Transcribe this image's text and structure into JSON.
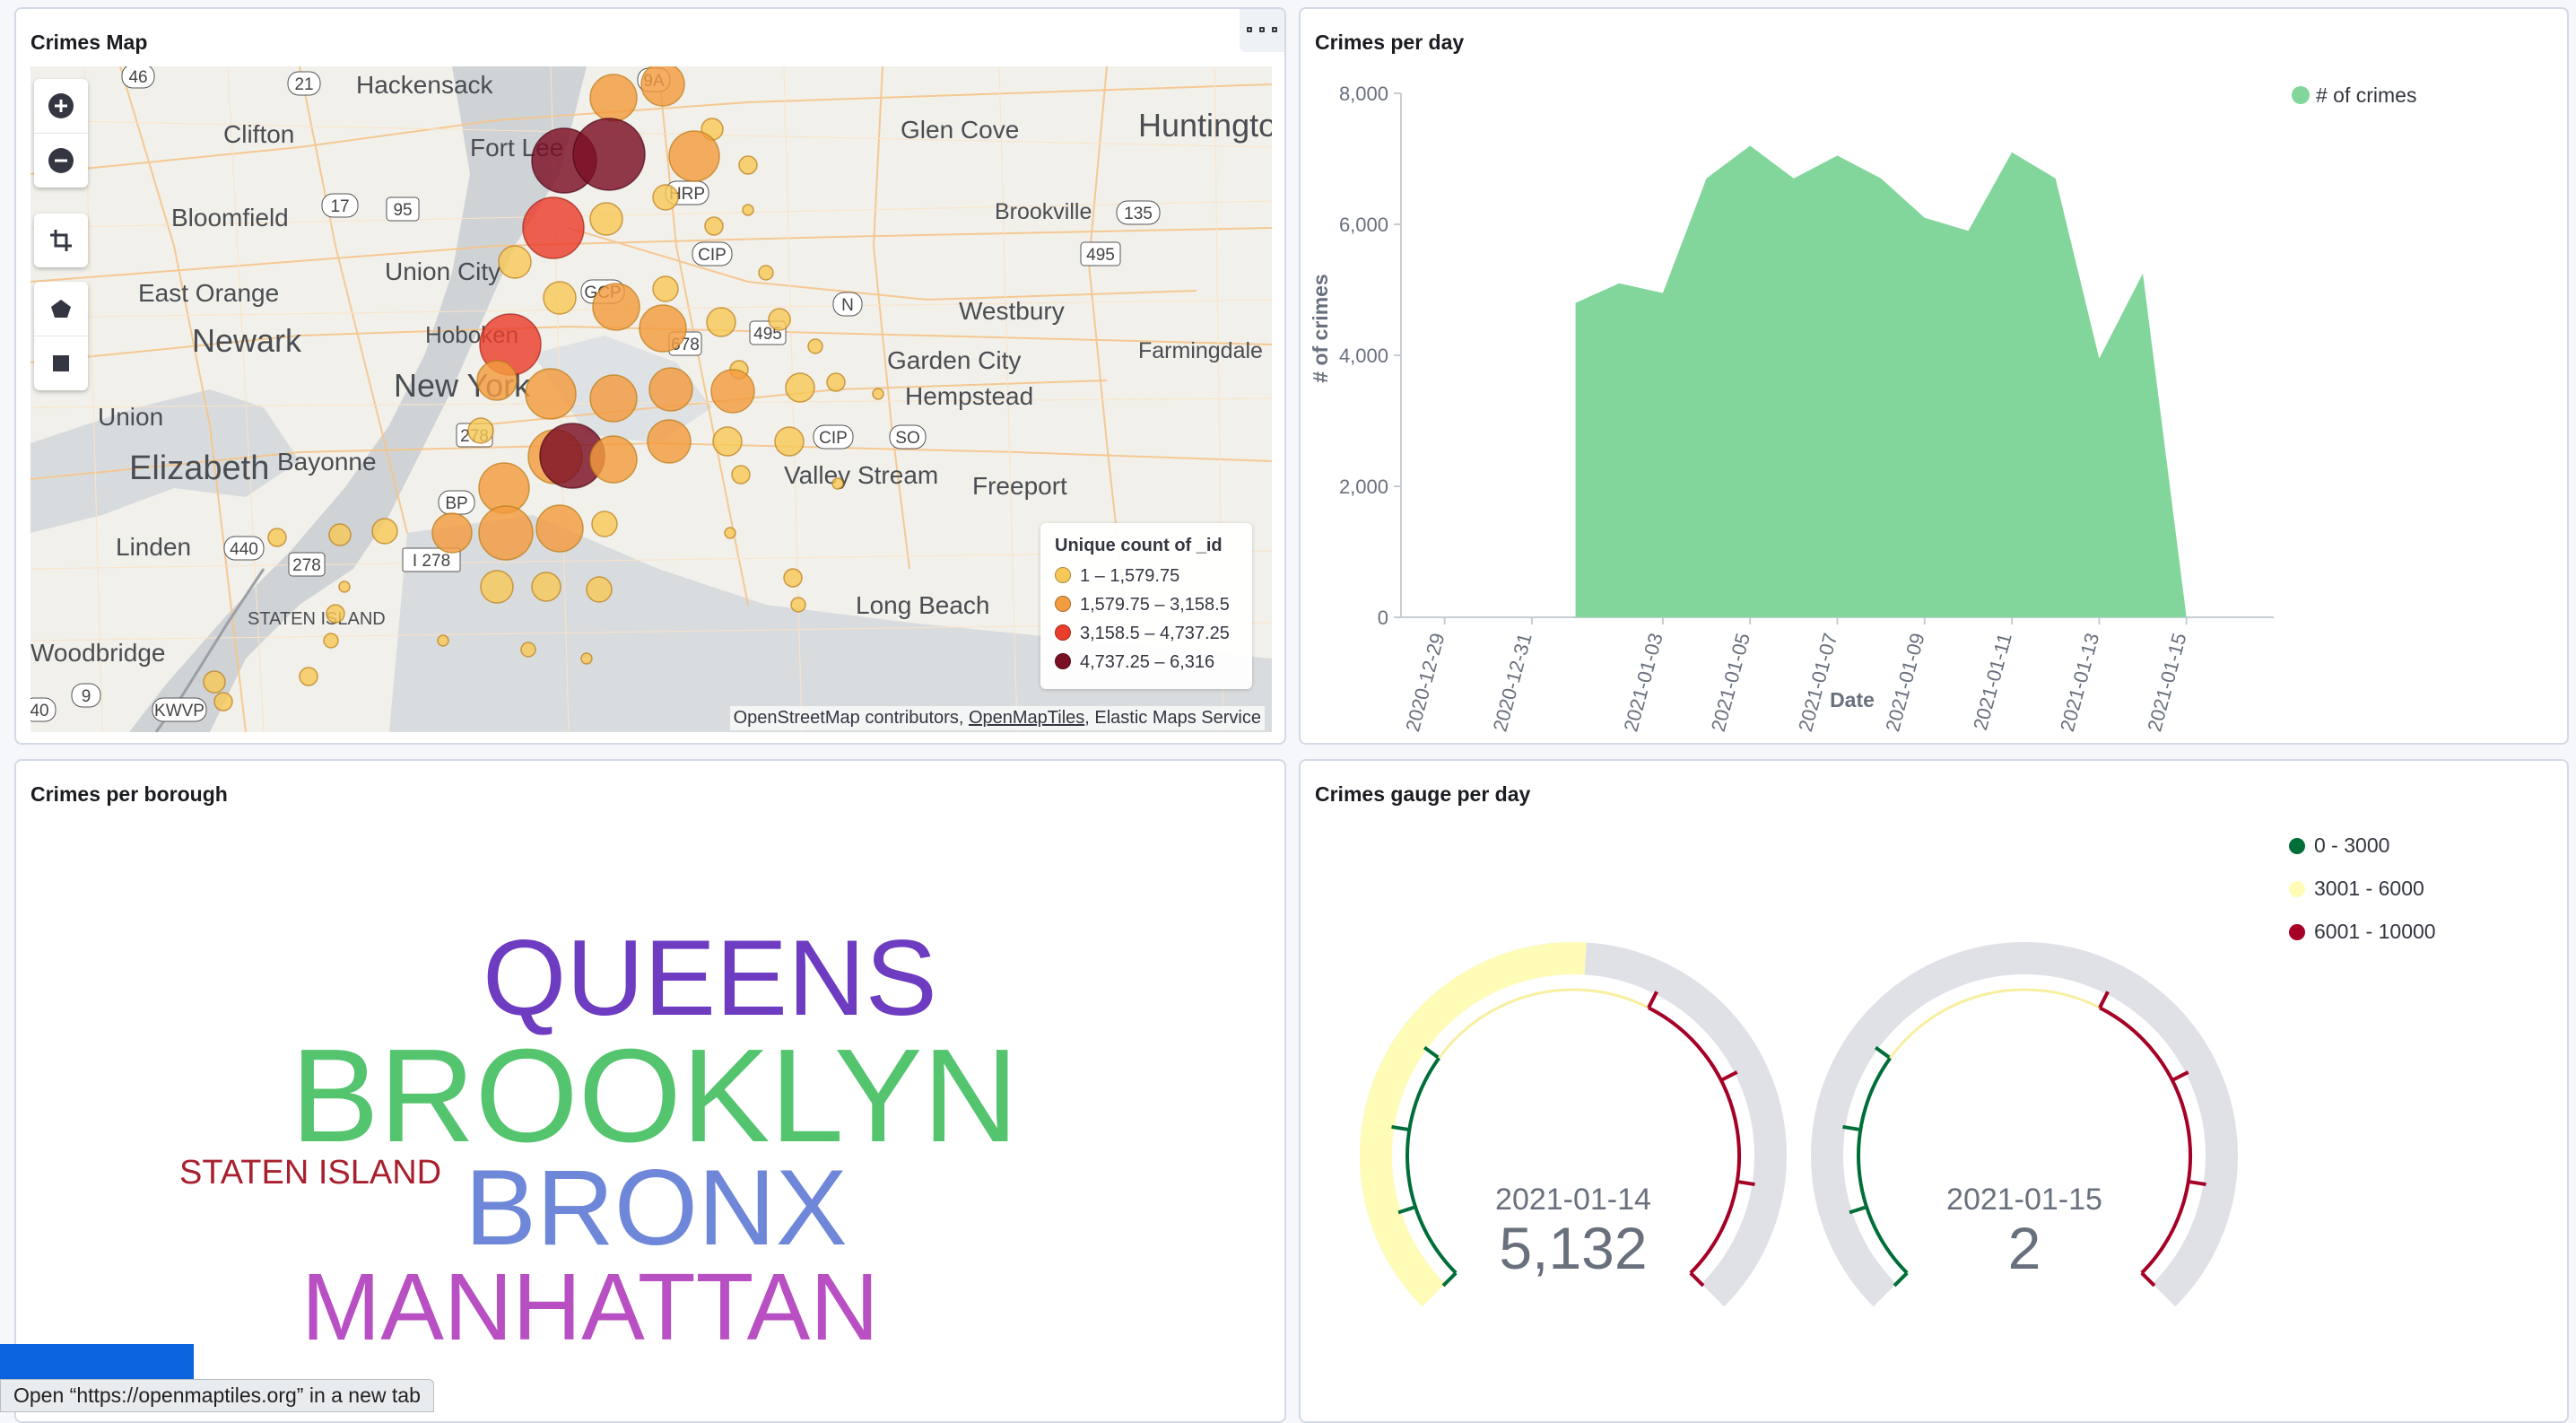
{
  "panels": {
    "map": {
      "title": "Crimes Map",
      "place_labels": [
        "Hackensack",
        "Clifton",
        "Fort Lee",
        "Glen Cove",
        "Huntington",
        "Bloomfield",
        "Brookville",
        "Union City",
        "East Orange",
        "Westbury",
        "Newark",
        "Hoboken",
        "Garden City",
        "Farmingdale",
        "New York",
        "Hempstead",
        "Union",
        "Elizabeth",
        "Bayonne",
        "Valley Stream",
        "Freeport",
        "Linden",
        "Long Beach",
        "STATEN ISLAND",
        "Woodbridge"
      ],
      "road_labels": [
        "46",
        "21",
        "17",
        "95",
        "HRP",
        "CIP",
        "135",
        "495",
        "GCP",
        "678",
        "N",
        "495",
        "278",
        "CIP",
        "SO",
        "BP",
        "440",
        "278",
        "I 278",
        "9",
        "KWVP",
        "40",
        "9A"
      ],
      "legend": {
        "title": "Unique count of _id",
        "items": [
          {
            "label": "1 – 1,579.75",
            "color": "#f6c858"
          },
          {
            "label": "1,579.75 – 3,158.5",
            "color": "#f39b3f"
          },
          {
            "label": "3,158.5 – 4,737.25",
            "color": "#ea3d2c"
          },
          {
            "label": "4,737.25 – 6,316",
            "color": "#7b0f24"
          }
        ]
      },
      "attribution": {
        "a": "OpenStreetMap contributors, ",
        "b": "OpenMapTiles",
        "c": ", Elastic Maps Service"
      },
      "tools": [
        "plus-icon",
        "minus-icon",
        "crop-icon",
        "polygon-icon",
        "square-icon"
      ]
    },
    "per_day": {
      "title": "Crimes per day"
    },
    "per_borough": {
      "title": "Crimes per borough",
      "words": [
        {
          "text": "QUEENS",
          "color": "#6d3cc1"
        },
        {
          "text": "BROOKLYN",
          "color": "#54c46e"
        },
        {
          "text": "STATEN ISLAND",
          "color": "#a8202f"
        },
        {
          "text": "BRONX",
          "color": "#6f87d8"
        },
        {
          "text": "MANHATTAN",
          "color": "#b84fc2"
        }
      ]
    },
    "gauge": {
      "title": "Crimes gauge per day",
      "legend": [
        {
          "label": "0 - 3000",
          "color": "#006e38"
        },
        {
          "label": "3001 - 6000",
          "color": "#fffcb8"
        },
        {
          "label": "6001 - 10000",
          "color": "#a50026"
        }
      ],
      "gauges": [
        {
          "date": "2021-01-14",
          "value": 5132,
          "display": "5,132"
        },
        {
          "date": "2021-01-15",
          "value": 2,
          "display": "2"
        }
      ],
      "max": 10000
    }
  },
  "chart_data": {
    "type": "area",
    "title": "",
    "xlabel": "Date",
    "ylabel": "# of crimes",
    "legend": "# of crimes",
    "legend_position": "top-right",
    "ylim": [
      0,
      8000
    ],
    "yticks": [
      "0",
      "2,000",
      "4,000",
      "6,000",
      "8,000"
    ],
    "xticks": [
      "2020-12-29",
      "2020-12-31",
      "2021-01-03",
      "2021-01-05",
      "2021-01-07",
      "2021-01-09",
      "2021-01-11",
      "2021-01-13",
      "2021-01-15"
    ],
    "x": [
      "2021-01-01",
      "2021-01-02",
      "2021-01-03",
      "2021-01-04",
      "2021-01-05",
      "2021-01-06",
      "2021-01-07",
      "2021-01-08",
      "2021-01-09",
      "2021-01-10",
      "2021-01-11",
      "2021-01-12",
      "2021-01-13",
      "2021-01-14",
      "2021-01-15"
    ],
    "series": [
      {
        "name": "# of crimes",
        "color": "#82d69b",
        "values": [
          4800,
          5100,
          4950,
          6700,
          7200,
          6700,
          7050,
          6700,
          6100,
          5900,
          7100,
          6700,
          3950,
          5250,
          2
        ]
      }
    ],
    "grid": false
  },
  "tooltip": "Open “https://openmaptiles.org” in a new tab"
}
